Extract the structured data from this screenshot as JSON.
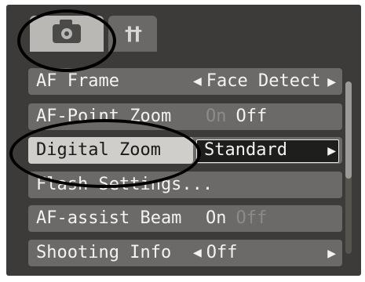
{
  "tabs": {
    "camera_tab_icon": "camera-icon",
    "settings_tab_icon": "wrench-icon",
    "settings_glyph": "††"
  },
  "menu": {
    "items": [
      {
        "label": "AF Frame",
        "value": "Face Detect"
      },
      {
        "label": "AF-Point Zoom",
        "option_on": "On",
        "option_off": "Off"
      },
      {
        "label": "Digital Zoom",
        "value": "Standard"
      },
      {
        "label": "Flash Settings..."
      },
      {
        "label": "AF-assist Beam",
        "option_on": "On",
        "option_off": "Off"
      },
      {
        "label": "Shooting Info",
        "value": "Off"
      }
    ]
  },
  "colors": {
    "panel_bg": "#3c3b39",
    "row_bg": "#6b6a68",
    "highlight_bg": "#cfcecb",
    "selected_value_bg": "#1e1e1d"
  }
}
